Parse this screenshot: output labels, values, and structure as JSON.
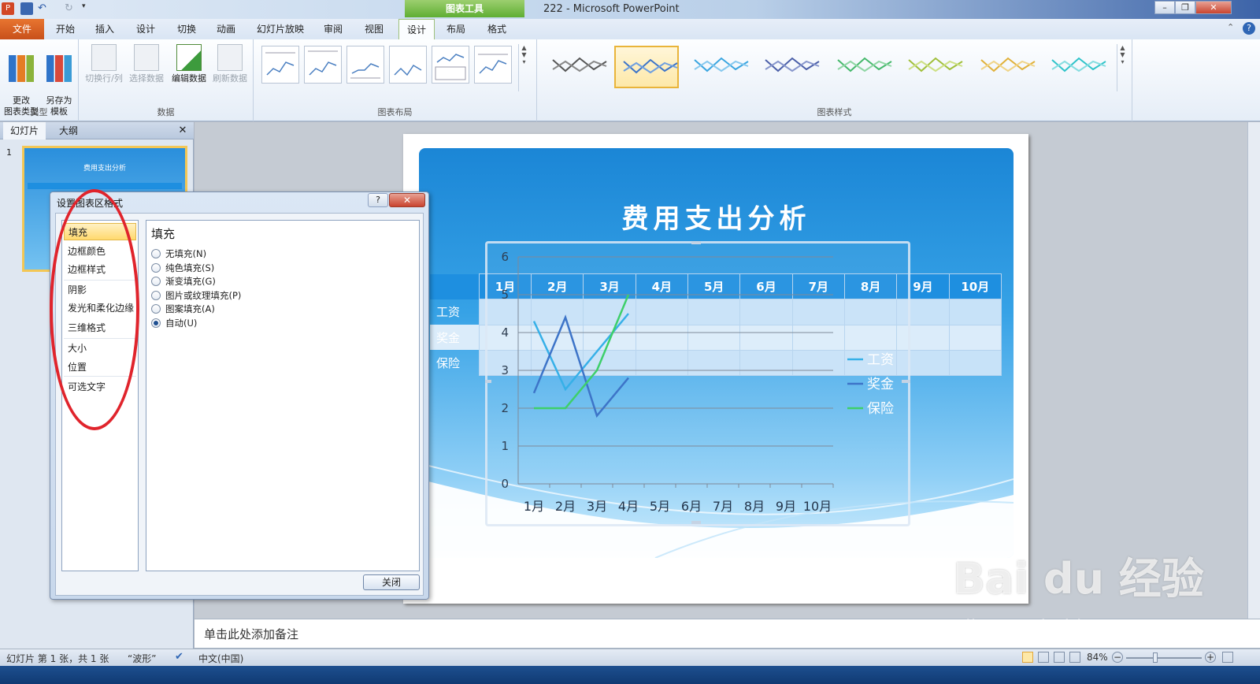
{
  "window": {
    "title": "222 - Microsoft PowerPoint",
    "tools_band": "图表工具",
    "minimize": "–",
    "restore": "❐",
    "close": "✕"
  },
  "tabs": [
    "开始",
    "插入",
    "设计",
    "切换",
    "动画",
    "幻灯片放映",
    "审阅",
    "视图",
    "设计",
    "布局",
    "格式"
  ],
  "file_tab": "文件",
  "ribbon": {
    "type_group": {
      "label": "类型",
      "change_type": "更改\n图表类型",
      "save_template": "另存为\n模板"
    },
    "data_group": {
      "label": "数据",
      "switch_row_col": "切换行/列",
      "select_data": "选择数据",
      "edit_data": "编辑数据",
      "refresh_data": "刷新数据"
    },
    "layout_group": {
      "label": "图表布局"
    },
    "style_group": {
      "label": "图表样式"
    },
    "colors": {
      "accent": "#4a7fc1",
      "selected_border": "#e9b43a"
    }
  },
  "pane": {
    "tab_slides": "幻灯片",
    "tab_outline": "大纲",
    "close": "✕",
    "slide_number": "1",
    "thumb_title": "费用支出分析"
  },
  "slide": {
    "title": "费用支出分析",
    "table": {
      "months": [
        "1月",
        "2月",
        "3月",
        "4月",
        "5月",
        "6月",
        "7月",
        "8月",
        "9月",
        "10月"
      ],
      "rows": [
        "工资",
        "奖金",
        "保险"
      ]
    }
  },
  "chart_data": {
    "type": "line",
    "title": "",
    "xlabel": "",
    "ylabel": "",
    "categories": [
      "1月",
      "2月",
      "3月",
      "4月",
      "5月",
      "6月",
      "7月",
      "8月",
      "9月",
      "10月"
    ],
    "ylim": [
      0,
      6
    ],
    "yticks": [
      "0",
      "1",
      "2",
      "3",
      "4",
      "5",
      "6"
    ],
    "grid": true,
    "legend": "right",
    "series": [
      {
        "name": "工资",
        "color": "#36b0e8",
        "values": [
          4.3,
          2.5,
          3.5,
          4.5
        ]
      },
      {
        "name": "奖金",
        "color": "#3d74c8",
        "values": [
          2.4,
          4.4,
          1.8,
          2.8
        ]
      },
      {
        "name": "保险",
        "color": "#3ecf6a",
        "values": [
          2.0,
          2.0,
          3.0,
          5.0
        ]
      }
    ]
  },
  "dialog": {
    "title": "设置图表区格式",
    "help": "?",
    "close_x": "✕",
    "nav": [
      "填充",
      "边框颜色",
      "边框样式",
      "阴影",
      "发光和柔化边缘",
      "三维格式",
      "大小",
      "位置",
      "可选文字"
    ],
    "section_title": "填充",
    "options": [
      "无填充(N)",
      "纯色填充(S)",
      "渐变填充(G)",
      "图片或纹理填充(P)",
      "图案填充(A)",
      "自动(U)"
    ],
    "selected_option": "自动(U)",
    "close_button": "关闭"
  },
  "notes": {
    "placeholder": "单击此处添加备注"
  },
  "status": {
    "slide_info": "幻灯片 第 1 张，共 1 张",
    "theme": "“波形”",
    "language": "中文(中国)",
    "zoom": "84%"
  },
  "watermark": {
    "brand": "Bai du 经验",
    "url": "jingyan.baidu.com"
  }
}
